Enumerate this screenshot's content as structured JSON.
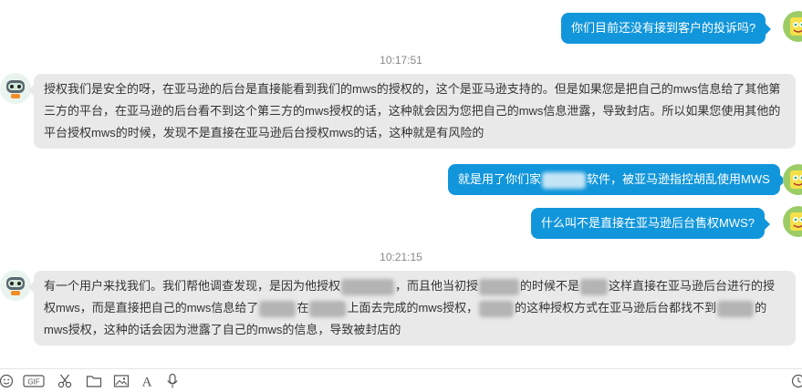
{
  "messages": [
    {
      "id": "m1",
      "direction": "outgoing",
      "text": "你们目前还没有接到客户的投诉吗?"
    },
    {
      "id": "m2",
      "direction": "incoming",
      "lines": [
        "授权我们是安全的呀，在亚马逊的后台是直接能看到我们的mws的授权的，这个是亚马逊支持的。但是如果您是把自己的mws信息给了其他第",
        "三方的平台，在亚马逊的后台看不到这个第三方的mws授权的话，这种就会因为您把自己的mws信息泄露，导致封店。所以如果您使用其他的",
        "平台授权mws的时候，发现不是直接在亚马逊后台授权mws的话，这种就是有风险的"
      ]
    },
    {
      "id": "m3",
      "direction": "outgoing",
      "parts": [
        "就是用了你们家",
        "软件，被亚马逊指控胡乱使用MWS"
      ]
    },
    {
      "id": "m4",
      "direction": "outgoing",
      "text": "什么叫不是直接在亚马逊后台售权MWS?"
    },
    {
      "id": "m5",
      "direction": "incoming",
      "lines": [
        [
          "有一个用户来找我们。我们帮他调查发现，是因为他授权",
          "，而且他当初授",
          "的时候不是",
          "这样直接在亚马逊后台进行的授"
        ],
        [
          "权mws，而是直接把自己的mws信息给了",
          "在",
          "上面去完成的mws授权，",
          "的这种授权方式在亚马逊后台都找不到",
          "的"
        ],
        [
          "mws授权，这种的话会因为泄露了自己的mws的信息，导致被封店的"
        ]
      ]
    }
  ],
  "timestamps": {
    "t1": "10:17:51",
    "t2": "10:21:15"
  },
  "toolbar": {
    "items": [
      "emoji-icon",
      "gif-icon",
      "scissors-icon",
      "folder-icon",
      "image-icon",
      "font-icon",
      "microphone-icon"
    ],
    "gif_label": "GIF",
    "font_label": "A"
  },
  "colors": {
    "outgoing_bubble": "#1296db",
    "incoming_bubble": "#e9e9e9",
    "timestamp": "#888888"
  }
}
